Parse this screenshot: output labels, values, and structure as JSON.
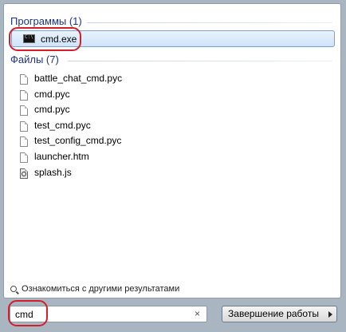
{
  "programs": {
    "header": "Программы (1)",
    "items": [
      {
        "label": "cmd.exe",
        "icon": "console-icon"
      }
    ]
  },
  "files": {
    "header": "Файлы (7)",
    "items": [
      {
        "label": "battle_chat_cmd.pyc",
        "icon": "file-icon"
      },
      {
        "label": "cmd.pyc",
        "icon": "file-icon"
      },
      {
        "label": "cmd.pyc",
        "icon": "file-icon"
      },
      {
        "label": "test_cmd.pyc",
        "icon": "file-icon"
      },
      {
        "label": "test_config_cmd.pyc",
        "icon": "file-icon"
      },
      {
        "label": "launcher.htm",
        "icon": "file-icon"
      },
      {
        "label": "splash.js",
        "icon": "script-icon"
      }
    ]
  },
  "more_results": {
    "label": "Ознакомиться с другими результатами",
    "icon": "search-icon"
  },
  "search": {
    "value": "cmd",
    "clear_glyph": "×"
  },
  "shutdown": {
    "label": "Завершение работы",
    "icon": "arrow-right-icon"
  },
  "colors": {
    "header_text": "#1e3287",
    "highlight_border": "#7da2ce",
    "annotation_red": "#d41e2a"
  }
}
